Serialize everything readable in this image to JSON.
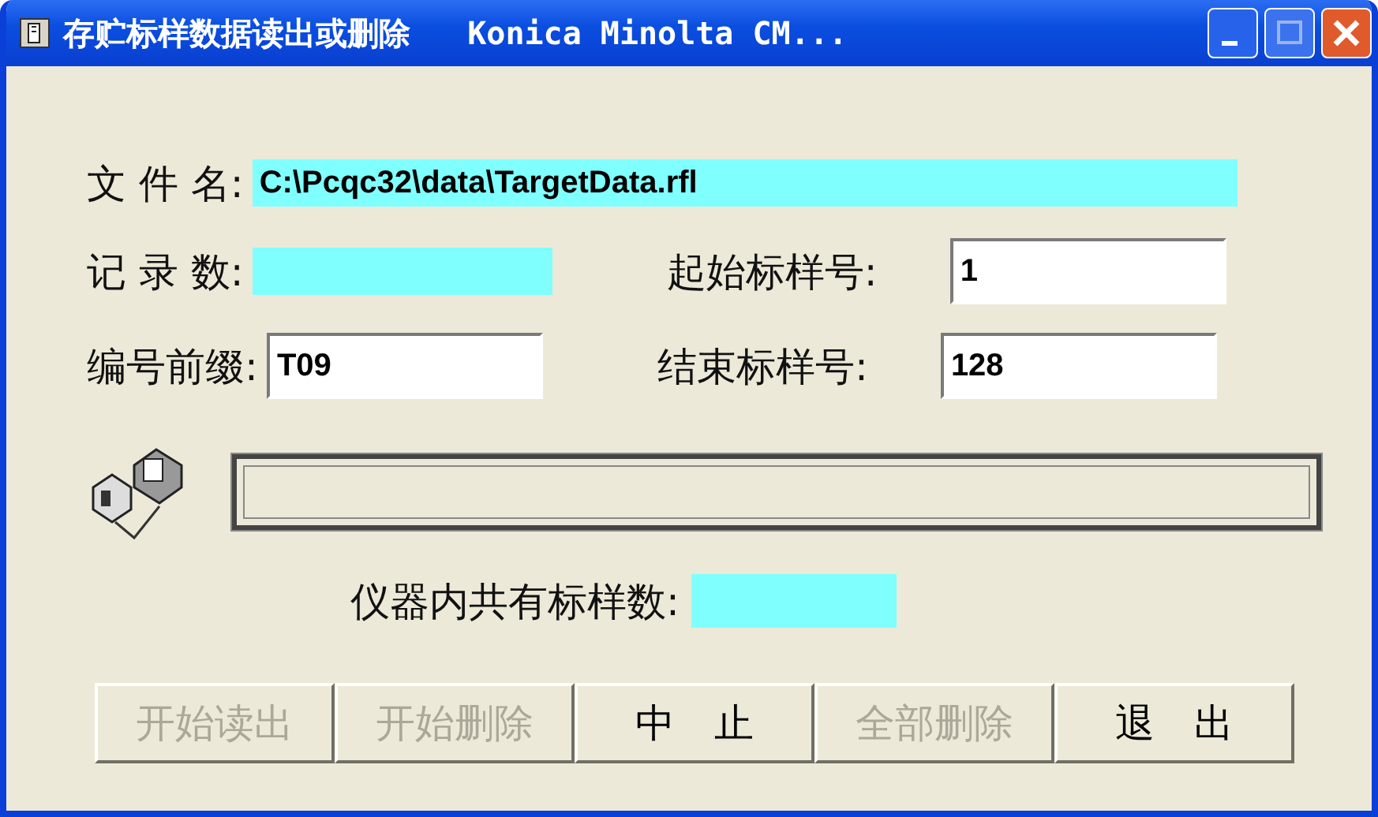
{
  "window": {
    "title": "存贮标样数据读出或删除   Konica Minolta CM..."
  },
  "file": {
    "label": "文 件 名:",
    "value": "C:\\Pcqc32\\data\\TargetData.rfl"
  },
  "record_count": {
    "label": "记 录 数:"
  },
  "start_no": {
    "label": "起始标样号:",
    "value": "1"
  },
  "prefix": {
    "label": "编号前缀:",
    "value": "T09"
  },
  "end_no": {
    "label": "结束标样号:",
    "value": "128"
  },
  "device_count": {
    "label": "仪器内共有标样数:"
  },
  "buttons": [
    {
      "label": "开始读出",
      "disabled": true
    },
    {
      "label": "开始删除",
      "disabled": true
    },
    {
      "label": "中　止",
      "disabled": false
    },
    {
      "label": "全部删除",
      "disabled": true
    },
    {
      "label": "退　出",
      "disabled": false
    }
  ]
}
